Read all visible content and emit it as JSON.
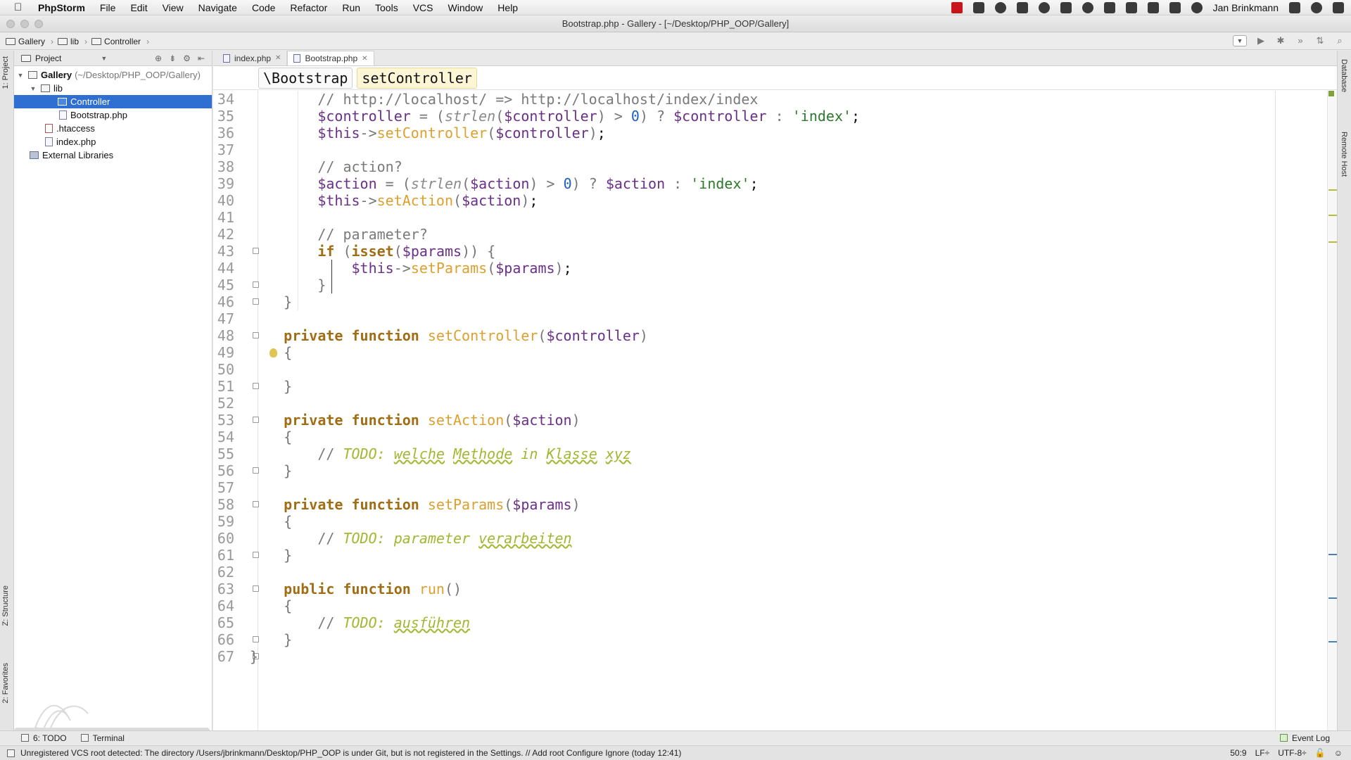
{
  "menubar": {
    "app": "PhpStorm",
    "items": [
      "File",
      "Edit",
      "View",
      "Navigate",
      "Code",
      "Refactor",
      "Run",
      "Tools",
      "VCS",
      "Window",
      "Help"
    ],
    "user": "Jan Brinkmann"
  },
  "window": {
    "title": "Bootstrap.php - Gallery - [~/Desktop/PHP_OOP/Gallery]"
  },
  "navbar": {
    "crumbs": [
      "Gallery",
      "lib",
      "Controller"
    ]
  },
  "toolwindows": {
    "left": [
      "1: Project",
      "Z: Structure",
      "2: Favorites"
    ],
    "right": [
      "Database",
      "Remote Host"
    ]
  },
  "project": {
    "header": "Project",
    "tree": [
      {
        "label": "Gallery",
        "hint": "(~/Desktop/PHP_OOP/Gallery)"
      },
      {
        "label": "lib"
      },
      {
        "label": "Controller"
      },
      {
        "label": "Bootstrap.php"
      },
      {
        "label": ".htaccess"
      },
      {
        "label": "index.php"
      },
      {
        "label": "External Libraries"
      }
    ]
  },
  "tabs": [
    {
      "label": "index.php"
    },
    {
      "label": "Bootstrap.php"
    }
  ],
  "breadcrumb": {
    "class": "\\Bootstrap",
    "method": "setController"
  },
  "lines": [
    "34",
    "35",
    "36",
    "37",
    "38",
    "39",
    "40",
    "41",
    "42",
    "43",
    "44",
    "45",
    "46",
    "47",
    "48",
    "49",
    "50",
    "51",
    "52",
    "53",
    "54",
    "55",
    "56",
    "57",
    "58",
    "59",
    "60",
    "61",
    "62",
    "63",
    "64",
    "65",
    "66",
    "67"
  ],
  "bottombar": {
    "todo": "6: TODO",
    "terminal": "Terminal",
    "eventlog": "Event Log"
  },
  "status": {
    "message": "Unregistered VCS root detected: The directory /Users/jbrinkmann/Desktop/PHP_OOP is under Git, but is not registered in the Settings. // Add root  Configure  Ignore (today 12:41)",
    "position": "50:9",
    "line_sep": "LF÷",
    "encoding": "UTF-8÷"
  },
  "colors": {
    "selection": "#2f6fd2",
    "keyword": "#a16d14",
    "function": "#dda02e",
    "variable": "#6a2f8a",
    "todo": "#a0b830"
  }
}
